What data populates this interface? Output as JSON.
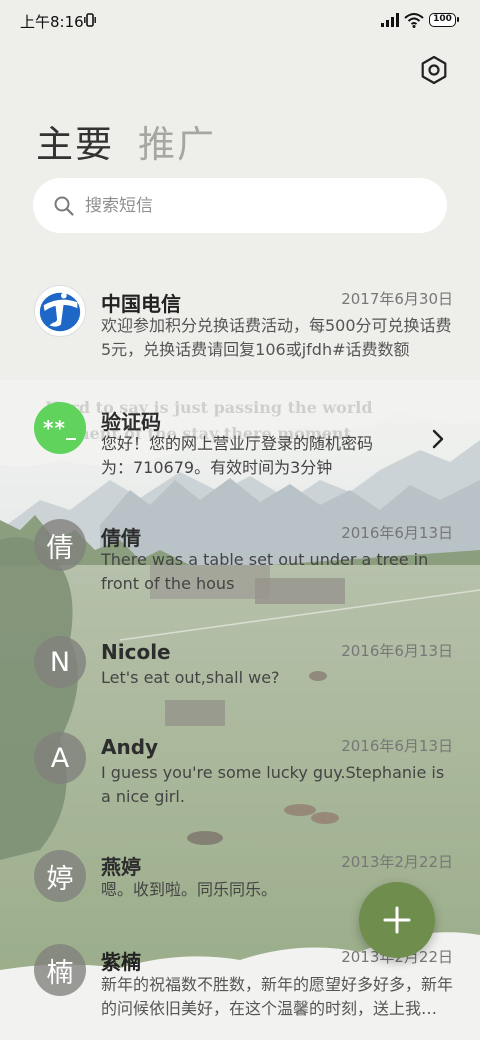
{
  "status_bar": {
    "time": "上午8:16",
    "battery": "100"
  },
  "header": {
    "tabs": [
      {
        "label": "主要",
        "active": true
      },
      {
        "label": "推广",
        "active": false
      }
    ]
  },
  "search": {
    "placeholder": "搜索短信"
  },
  "background_quote": "Hard to say is just passing the world moment of the stay there moment",
  "conversations": [
    {
      "avatar": "",
      "avatar_kind": "telecom-logo",
      "name": "中国电信",
      "date": "2017年6月30日",
      "preview": "欢迎参加积分兑换话费活动，每500分可兑换话费5元，兑换话费请回复106或jfdh#话费数额"
    },
    {
      "avatar": "**_",
      "avatar_kind": "code",
      "name": "验证码",
      "date": "",
      "preview": "您好！您的网上营业厅登录的随机密码为：710679。有效时间为3分钟"
    },
    {
      "avatar": "倩",
      "avatar_kind": "letter",
      "name": "倩倩",
      "date": "2016年6月13日",
      "preview": "There was a table set out under a tree in front of the hous"
    },
    {
      "avatar": "N",
      "avatar_kind": "letter",
      "name": "Nicole",
      "date": "2016年6月13日",
      "preview": "Let's eat out,shall we?"
    },
    {
      "avatar": "A",
      "avatar_kind": "letter",
      "name": "Andy",
      "date": "2016年6月13日",
      "preview": "I guess you're some lucky guy.Stephanie is a nice girl."
    },
    {
      "avatar": "婷",
      "avatar_kind": "letter",
      "name": "燕婷",
      "date": "2013年2月22日",
      "preview": "嗯。收到啦。同乐同乐。"
    },
    {
      "avatar": "楠",
      "avatar_kind": "letter",
      "name": "紫楠",
      "date": "2013年2月22日",
      "preview": "新年的祝福数不胜数，新年的愿望好多好多，新年的问候依旧美好，在这个温馨的时刻，送上我的祝福"
    }
  ],
  "colors": {
    "accent": "#6f8d4c",
    "avatar_bg": "#80807c",
    "code_avatar": "#5fd35b"
  },
  "icons": {
    "settings": "gear-icon",
    "search": "search-icon",
    "compose": "plus-icon",
    "expand": "chevron-right-icon"
  }
}
